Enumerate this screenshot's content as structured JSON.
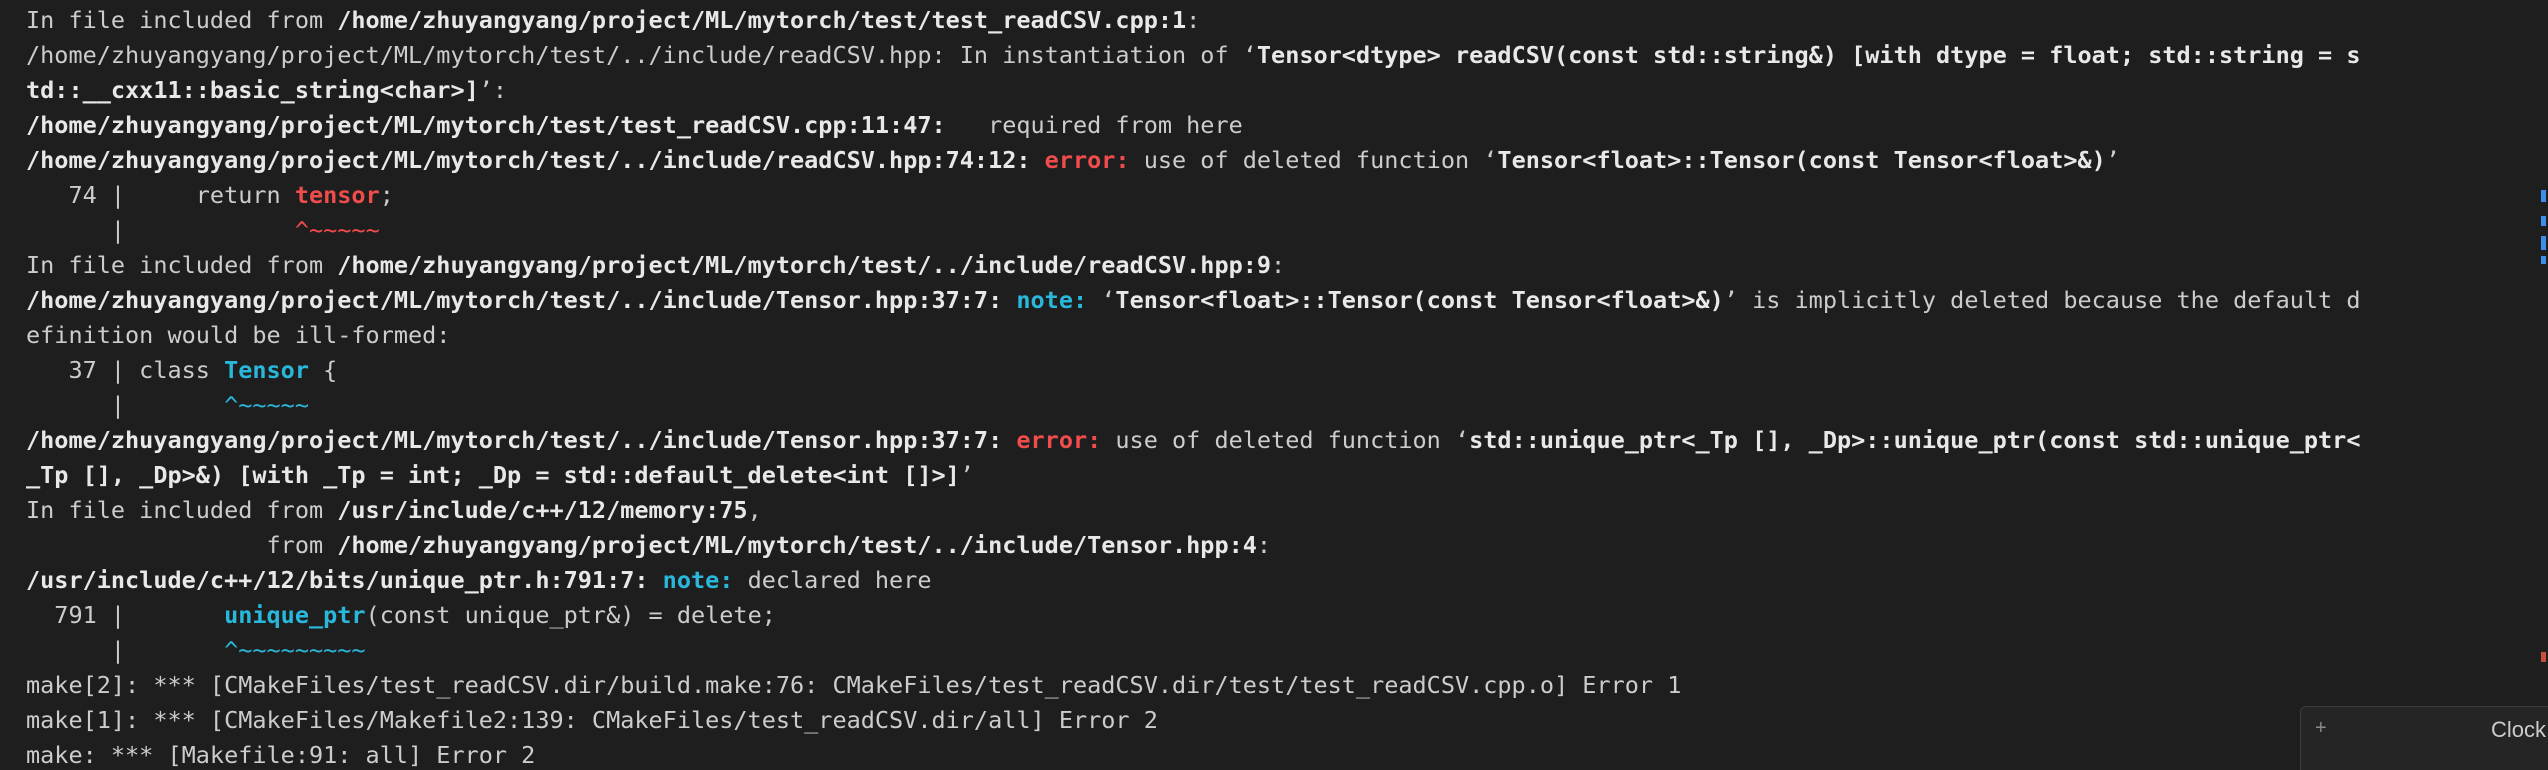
{
  "terminal": {
    "l1": {
      "t0": "In file included from ",
      "t1": "/home/zhuyangyang/project/ML/mytorch/test/test_readCSV.cpp:1",
      "t2": ":"
    },
    "l2": {
      "t0": "/home/zhuyangyang/project/ML/mytorch/test/../include/readCSV.hpp: In instantiation of ‘",
      "t1": "Tensor<dtype> readCSV(const std::string&) [with dtype = float; std::string = s"
    },
    "l3": {
      "t0": "td::__cxx11::basic_string<char>]",
      "t1": "’:"
    },
    "l4": {
      "t0": "/home/zhuyangyang/project/ML/mytorch/test/test_readCSV.cpp:11:47:",
      "t1": "   required from here"
    },
    "l5": {
      "t0": "/home/zhuyangyang/project/ML/mytorch/test/../include/readCSV.hpp:74:12: ",
      "t1": "error:",
      "t2": " use of deleted function ‘",
      "t3": "Tensor<float>::Tensor(const Tensor<float>&)",
      "t4": "’"
    },
    "l6": {
      "t0": "   74 |     return ",
      "t1": "tensor",
      "t2": ";"
    },
    "l7": {
      "t0": "      |            ",
      "t1": "^~~~~~"
    },
    "l8": {
      "t0": "In file included from ",
      "t1": "/home/zhuyangyang/project/ML/mytorch/test/../include/readCSV.hpp:9",
      "t2": ":"
    },
    "l9": {
      "t0": "/home/zhuyangyang/project/ML/mytorch/test/../include/Tensor.hpp:37:7: ",
      "t1": "note:",
      "t2": " ‘",
      "t3": "Tensor<float>::Tensor(const Tensor<float>&)",
      "t4": "’ is implicitly deleted because the default d"
    },
    "l10": {
      "t0": "efinition would be ill-formed:"
    },
    "l11": {
      "t0": "   37 | class ",
      "t1": "Tensor",
      "t2": " {"
    },
    "l12": {
      "t0": "      |       ",
      "t1": "^~~~~~"
    },
    "l13": {
      "t0": "/home/zhuyangyang/project/ML/mytorch/test/../include/Tensor.hpp:37:7: ",
      "t1": "error:",
      "t2": " use of deleted function ‘",
      "t3": "std::unique_ptr<_Tp [], _Dp>::unique_ptr(const std::unique_ptr<"
    },
    "l14": {
      "t0": "_Tp [], _Dp>&) [with _Tp = int; _Dp = std::default_delete<int []>]",
      "t1": "’"
    },
    "l15": {
      "t0": "In file included from ",
      "t1": "/usr/include/c++/12/memory:75",
      "t2": ","
    },
    "l16": {
      "t0": "                 from ",
      "t1": "/home/zhuyangyang/project/ML/mytorch/test/../include/Tensor.hpp:4",
      "t2": ":"
    },
    "l17": {
      "t0": "/usr/include/c++/12/bits/unique_ptr.h:791:7: ",
      "t1": "note:",
      "t2": " declared here"
    },
    "l18": {
      "t0": "  791 |       ",
      "t1": "unique_ptr",
      "t2": "(const unique_ptr&) = delete;"
    },
    "l19": {
      "t0": "      |       ",
      "t1": "^~~~~~~~~~"
    },
    "l20": {
      "t0": "make[2]: *** [CMakeFiles/test_readCSV.dir/build.make:76: CMakeFiles/test_readCSV.dir/test/test_readCSV.cpp.o] Error 1"
    },
    "l21": {
      "t0": "make[1]: *** [CMakeFiles/Makefile2:139: CMakeFiles/test_readCSV.dir/all] Error 2"
    },
    "l22": {
      "t0": "make: *** [Makefile:91: all] Error 2"
    }
  },
  "panel": {
    "add_icon": "+",
    "title": "Clock"
  },
  "colors": {
    "background": "#1e1e1e",
    "text": "#cccccc",
    "error": "#f14c4c",
    "note": "#29b8db"
  }
}
